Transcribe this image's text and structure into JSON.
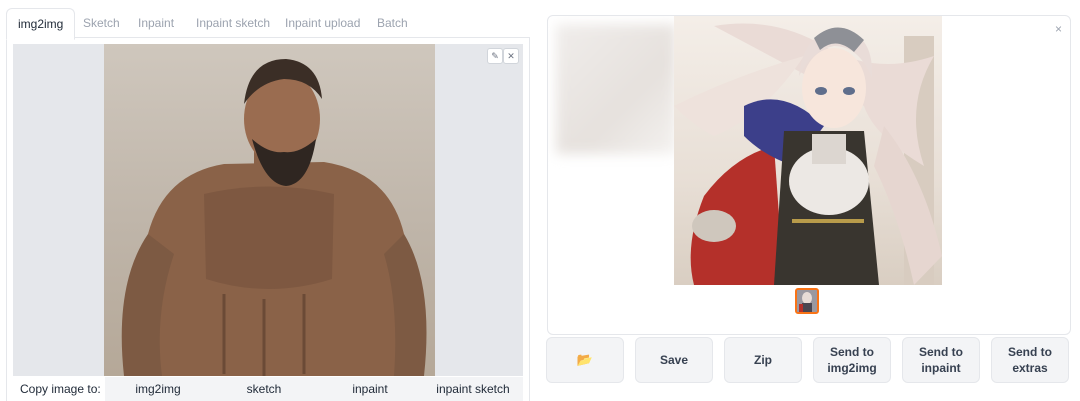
{
  "tabs": [
    {
      "label": "img2img",
      "active": true
    },
    {
      "label": "Sketch",
      "active": false
    },
    {
      "label": "Inpaint",
      "active": false
    },
    {
      "label": "Inpaint sketch",
      "active": false
    },
    {
      "label": "Inpaint upload",
      "active": false
    },
    {
      "label": "Batch",
      "active": false
    }
  ],
  "copy_row": {
    "label": "Copy image to:",
    "buttons": [
      "img2img",
      "sketch",
      "inpaint",
      "inpaint sketch"
    ]
  },
  "gallery": {
    "close": "×",
    "thumbnail_selected": true
  },
  "actions": {
    "folder_icon": "folder-icon",
    "save": "Save",
    "zip": "Zip",
    "send_img2img_line1": "Send to",
    "send_img2img_line2": "img2img",
    "send_inpaint_line1": "Send to",
    "send_inpaint_line2": "inpaint",
    "send_extras_line1": "Send to",
    "send_extras_line2": "extras"
  },
  "colors": {
    "accent": "#f97316",
    "tab_inactive": "#9ca3af",
    "button_bg": "#f3f4f6",
    "border": "#e5e7eb"
  }
}
